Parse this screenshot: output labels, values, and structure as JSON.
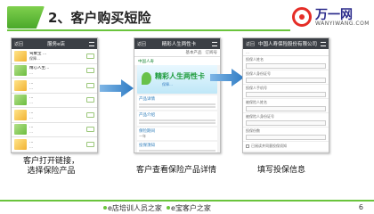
{
  "header": {
    "title": "2、客户购买短险",
    "logo_name": "万一网",
    "logo_sub": "WANYIWANG.COM",
    "accent_color": "#6ac43c"
  },
  "phone1": {
    "bar_title": "服务e店",
    "back": "返回",
    "items": [
      {
        "title": "驾乘宝 …",
        "desc": "保障…"
      },
      {
        "title": "精心人生…",
        "desc": "…"
      },
      {
        "title": "…",
        "desc": "…"
      },
      {
        "title": "…",
        "desc": "…"
      },
      {
        "title": "…",
        "desc": "…"
      },
      {
        "title": "…",
        "desc": "…"
      },
      {
        "title": "…",
        "desc": "…"
      }
    ]
  },
  "phone2": {
    "bar_title": "精彩人生两性卡",
    "back": "返回",
    "tabs": [
      "基本产品",
      "订阅号"
    ],
    "brand": "中国人寿",
    "banner_title": "精彩人生两性卡",
    "banner_sub": "保障…",
    "sections": [
      {
        "head": "产品详情",
        "body": "…"
      },
      {
        "head": "产品介绍",
        "body": "…"
      },
      {
        "head": "保险期间",
        "body": "一年"
      },
      {
        "head": "投保须知",
        "body": "…"
      },
      {
        "head": "保障内容",
        "body": "…"
      }
    ]
  },
  "phone3": {
    "bar_title": "中国人寿保险股份有限公司",
    "back": "返回",
    "sub": "…",
    "fields": [
      "投保人姓名",
      "投保人身份证号",
      "投保人手机号",
      "被保险人姓名",
      "被保险人身份证号",
      "投保份数"
    ],
    "agree": "已阅读并同意投保须知",
    "submit": "…"
  },
  "captions": {
    "step1_line1": "客户打开链接，",
    "step1_line2": "选择保险产品",
    "step2": "客户查看保险产品详情",
    "step3": "填写投保信息"
  },
  "footer": {
    "text": "e店培训人员之家  e宝客户之家",
    "part1": "e店培训人员之家",
    "part2": "e宝客户之家",
    "page": "6"
  }
}
